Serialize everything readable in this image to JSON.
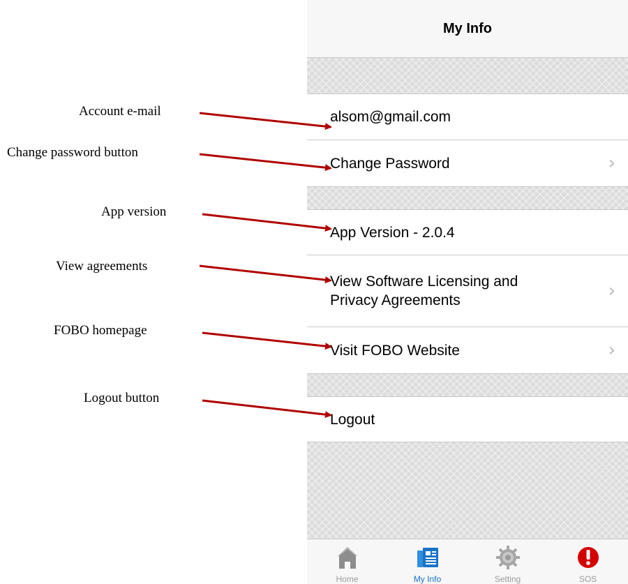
{
  "annotations": [
    {
      "id": "account_email",
      "text": "Account e-mail"
    },
    {
      "id": "change_password",
      "text": "Change password button"
    },
    {
      "id": "app_version",
      "text": "App version"
    },
    {
      "id": "view_agreements",
      "text": "View agreements"
    },
    {
      "id": "fobo_homepage",
      "text": "FOBO homepage"
    },
    {
      "id": "logout",
      "text": "Logout button"
    }
  ],
  "navbar": {
    "title": "My Info"
  },
  "rows": {
    "email": "alsom@gmail.com",
    "change_password": "Change Password",
    "app_version": "App Version - 2.0.4",
    "agreements_line1": "View Software Licensing and",
    "agreements_line2": "Privacy Agreements",
    "website": "Visit FOBO Website",
    "logout": "Logout"
  },
  "chevron": "›",
  "tabs": [
    {
      "label": "Home",
      "icon": "home-icon"
    },
    {
      "label": "My Info",
      "icon": "my-info-icon",
      "active": true
    },
    {
      "label": "Setting",
      "icon": "gear-icon"
    },
    {
      "label": "SOS",
      "icon": "sos-alert-icon"
    }
  ],
  "colors": {
    "arrow": "#b00000",
    "active_tab": "#1a73c8",
    "sos": "#d40000"
  }
}
